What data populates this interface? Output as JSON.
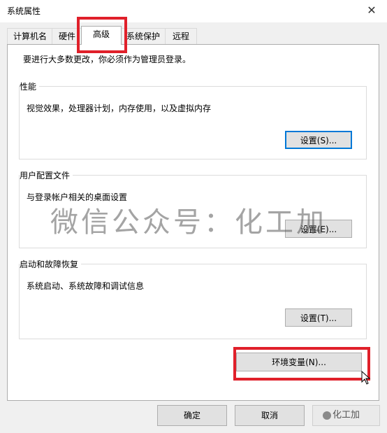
{
  "window": {
    "title": "系统属性",
    "close_symbol": "✕"
  },
  "tabs": [
    {
      "label": "计算机名",
      "active": false
    },
    {
      "label": "硬件",
      "active": false
    },
    {
      "label": "高级",
      "active": true
    },
    {
      "label": "系统保护",
      "active": false
    },
    {
      "label": "远程",
      "active": false
    }
  ],
  "panel": {
    "note": "要进行大多数更改，你必须作为管理员登录。",
    "performance": {
      "title": "性能",
      "desc": "视觉效果，处理器计划，内存使用，以及虚拟内存",
      "button": "设置(S)..."
    },
    "profiles": {
      "title": "用户配置文件",
      "desc": "与登录帐户相关的桌面设置",
      "button": "设置(E)..."
    },
    "startup": {
      "title": "启动和故障恢复",
      "desc": "系统启动、系统故障和调试信息",
      "button": "设置(T)..."
    },
    "env_button": "环境变量(N)..."
  },
  "footer": {
    "ok": "确定",
    "cancel": "取消"
  },
  "watermark": "微信公众号：化工加",
  "brand_badge": "化工加",
  "colors": {
    "highlight": "#e0202a",
    "focus": "#0078d7"
  }
}
